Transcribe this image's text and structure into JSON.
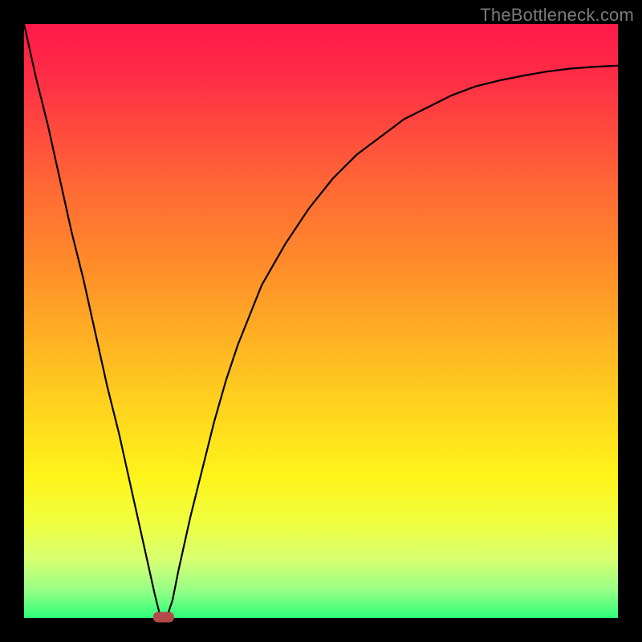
{
  "watermark": {
    "text": "TheBottleneck.com"
  },
  "chart_data": {
    "type": "line",
    "title": "",
    "xlabel": "",
    "ylabel": "",
    "xlim": [
      0,
      100
    ],
    "ylim": [
      0,
      100
    ],
    "grid": false,
    "legend": false,
    "background": "traffic-light-gradient",
    "series": [
      {
        "name": "bottleneck-curve",
        "x": [
          0,
          2,
          4,
          6,
          8,
          10,
          12,
          14,
          16,
          18,
          20,
          22,
          23,
          24,
          25,
          26,
          28,
          30,
          32,
          34,
          36,
          38,
          40,
          44,
          48,
          52,
          56,
          60,
          64,
          68,
          72,
          76,
          80,
          84,
          88,
          92,
          96,
          100
        ],
        "y": [
          100,
          91,
          83,
          74,
          65,
          57,
          48,
          39,
          31,
          22,
          13,
          4,
          0,
          0,
          3,
          8,
          17,
          25,
          33,
          40,
          46,
          51,
          56,
          63,
          69,
          74,
          78,
          81,
          84,
          86,
          88,
          89.5,
          90.5,
          91.3,
          92,
          92.5,
          92.8,
          93
        ]
      }
    ],
    "marker": {
      "x": 23.5,
      "y": 0,
      "shape": "pill",
      "color": "#b44a4a"
    }
  }
}
